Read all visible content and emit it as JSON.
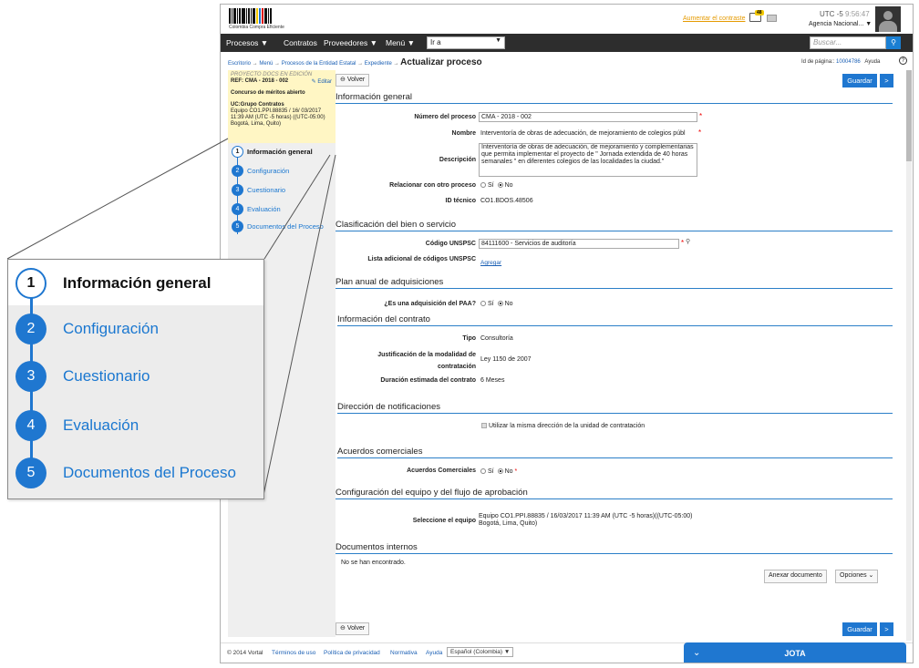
{
  "header": {
    "logo_text": "Colombia Compra Eficiente",
    "contrast_link": "Aumentar el contraste",
    "mail_badge": "48",
    "utc": "UTC -5",
    "time": "9:56:47",
    "agency": "Agencia Nacional..."
  },
  "nav": {
    "items": [
      "Procesos",
      "Contratos",
      "Proveedores",
      "Menú"
    ],
    "goto_value": "Ir a",
    "search_placeholder": "Buscar..."
  },
  "breadcrumb": {
    "items": [
      "Escritorio",
      "Menú",
      "Procesos de la Entidad Estatal",
      "Expediente"
    ],
    "current": "Actualizar proceso",
    "page_id_label": "Id de página::",
    "page_id": "10004786",
    "help": "Ayuda"
  },
  "process": {
    "draft": "PROYECTO DOCS EN EDICIÓN",
    "ref": "REF: CMA - 2018 - 002",
    "edit": "Editar",
    "type": "Concurso de méritos abierto",
    "uc": "UC:Grupo Contratos",
    "team_label": "Equipo:",
    "team": "Equipo CO1.PPI.88835 / 16/ 03/2017 11:39 AM (UTC -5 horas) ((UTC-05:00) Bogotá, Lima, Quito)"
  },
  "steps": [
    {
      "n": "1",
      "label": "Información general"
    },
    {
      "n": "2",
      "label": "Configuración"
    },
    {
      "n": "3",
      "label": "Cuestionario"
    },
    {
      "n": "4",
      "label": "Evaluación"
    },
    {
      "n": "5",
      "label": "Documentos del Proceso"
    }
  ],
  "buttons": {
    "back": "Volver",
    "save": "Guardar",
    "next": ">",
    "attach": "Anexar documento",
    "options": "Opciones"
  },
  "sections": {
    "general": "Información general",
    "classification": "Clasificación del bien o servicio",
    "annual": "Plan anual de adquisiciones",
    "contract": "Información del contrato",
    "notifications": "Dirección de notificaciones",
    "agreements": "Acuerdos comerciales",
    "team": "Configuración del equipo y del flujo de aprobación",
    "docs": "Documentos internos"
  },
  "form": {
    "number_label": "Número del proceso",
    "number": "CMA - 2018 - 002",
    "name_label": "Nombre",
    "name": "Interventoría de obras de adecuación, de mejoramiento de colegios públ",
    "desc_label": "Descripción",
    "desc": "Interventoría de obras de adecuación, de mejoramiento y complementarias que permita implementar el proyecto de \" Jornada extendida de 40 horas semanales \" en diferentes colegios de las localidades la ciudad.\"",
    "relate_label": "Relacionar con otro proceso",
    "yes": "Sí",
    "no": "No",
    "techid_label": "ID técnico",
    "techid": "CO1.BDOS.48506",
    "unspsc_label": "Código UNSPSC",
    "unspsc": "84111600 - Servicios de auditoría",
    "extra_label": "Lista adicional de códigos UNSPSC",
    "add": "Agregar",
    "paa_label": "¿Es una adquisición del PAA?",
    "type_label": "Tipo",
    "type": "Consultoría",
    "just_label": "Justificación de la modalidad de contratación",
    "just": "Ley 1150 de 2007",
    "dur_label": "Duración estimada del contrato",
    "dur": "6 Meses",
    "same_addr": "Utilizar la misma dirección de la unidad de contratación",
    "agree_label": "Acuerdos Comerciales",
    "team_sel_label": "Seleccione el equipo",
    "team_sel": "Equipo CO1.PPI.88835 / 16/03/2017 11:39 AM (UTC -5 horas)((UTC-05:00) Bogotá, Lima, Quito)",
    "no_docs": "No se han encontrado."
  },
  "footer": {
    "copy": "© 2014 Vortal",
    "links": [
      "Términos de uso",
      "Política de privacidad",
      "Normativa",
      "Ayuda"
    ],
    "lang": "Español (Colombia)",
    "chat": "JOTA"
  }
}
